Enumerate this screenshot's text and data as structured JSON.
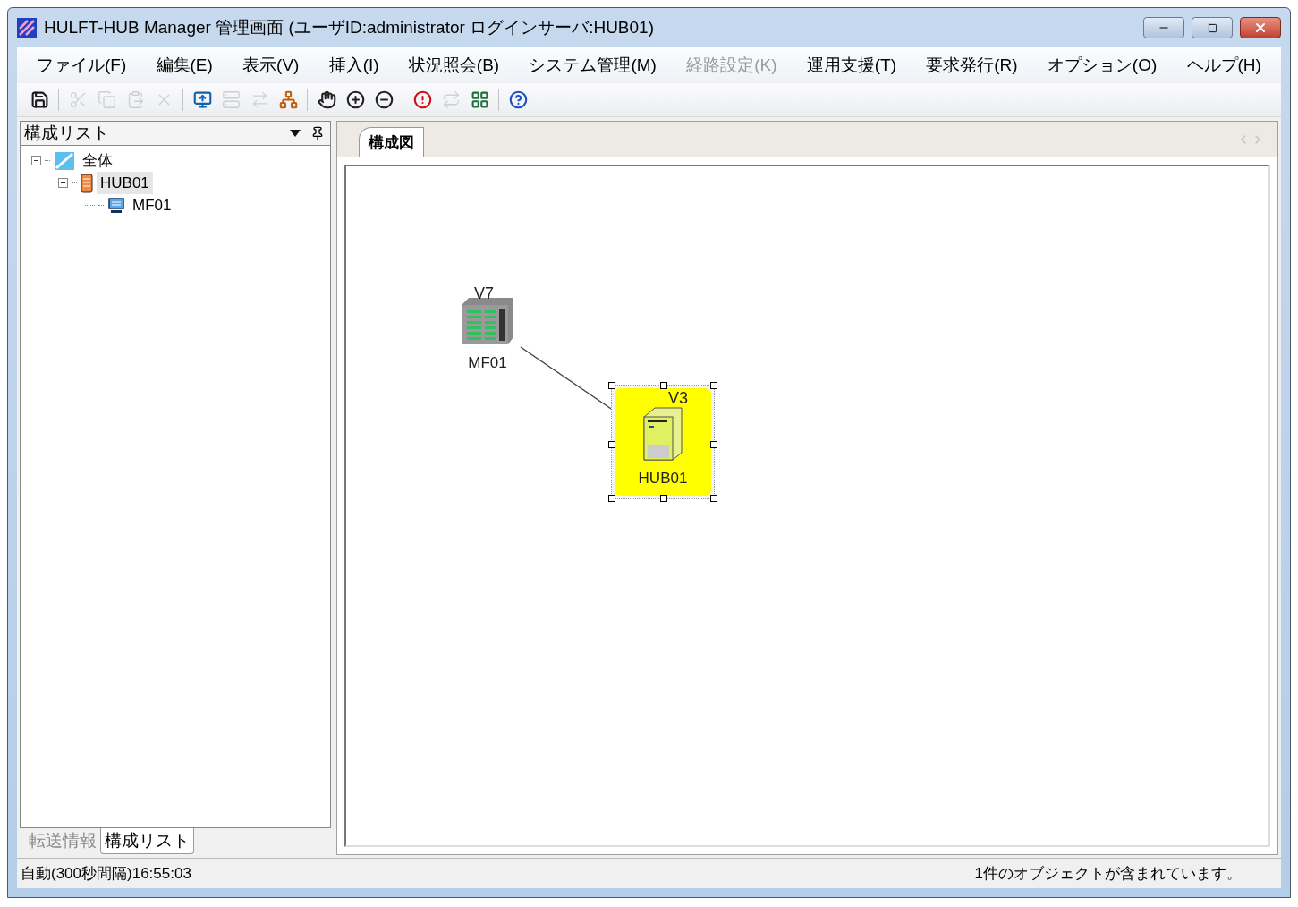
{
  "window": {
    "title": "HULFT-HUB Manager 管理画面 (ユーザID:administrator ログインサーバ:HUB01)"
  },
  "menu": [
    {
      "before": "ファイル(",
      "key": "F",
      "after": ")",
      "disabled": false
    },
    {
      "before": "編集(",
      "key": "E",
      "after": ")",
      "disabled": false
    },
    {
      "before": "表示(",
      "key": "V",
      "after": ")",
      "disabled": false
    },
    {
      "before": "挿入(",
      "key": "I",
      "after": ")",
      "disabled": false
    },
    {
      "before": "状況照会(",
      "key": "B",
      "after": ")",
      "disabled": false
    },
    {
      "before": "システム管理(",
      "key": "M",
      "after": ")",
      "disabled": false
    },
    {
      "before": "経路設定(",
      "key": "K",
      "after": ")",
      "disabled": true
    },
    {
      "before": "運用支援(",
      "key": "T",
      "after": ")",
      "disabled": false
    },
    {
      "before": "要求発行(",
      "key": "R",
      "after": ")",
      "disabled": false
    },
    {
      "before": "オプション(",
      "key": "O",
      "after": ")",
      "disabled": false
    },
    {
      "before": "ヘルプ(",
      "key": "H",
      "after": ")",
      "disabled": false
    }
  ],
  "toolbar": [
    {
      "kind": "save",
      "disabled": false
    },
    {
      "kind": "separator"
    },
    {
      "kind": "cut",
      "disabled": true
    },
    {
      "kind": "copy",
      "disabled": true
    },
    {
      "kind": "paste",
      "disabled": true
    },
    {
      "kind": "delete",
      "disabled": true
    },
    {
      "kind": "separator"
    },
    {
      "kind": "add-monitor",
      "disabled": false
    },
    {
      "kind": "add-server",
      "disabled": true
    },
    {
      "kind": "route",
      "disabled": true
    },
    {
      "kind": "add-network",
      "disabled": false
    },
    {
      "kind": "separator"
    },
    {
      "kind": "hand",
      "disabled": false
    },
    {
      "kind": "zoom-in",
      "disabled": false
    },
    {
      "kind": "zoom-out",
      "disabled": false
    },
    {
      "kind": "separator"
    },
    {
      "kind": "alert",
      "disabled": false
    },
    {
      "kind": "transfer",
      "disabled": true
    },
    {
      "kind": "diagram",
      "disabled": false
    },
    {
      "kind": "separator"
    },
    {
      "kind": "help",
      "disabled": false
    }
  ],
  "left_panel": {
    "title": "構成リスト",
    "tree": [
      {
        "label": "全体",
        "kind": "all",
        "expanded": true,
        "selected": false,
        "children": [
          {
            "label": "HUB01",
            "kind": "hub",
            "expanded": true,
            "selected": true,
            "children": [
              {
                "label": "MF01",
                "kind": "host",
                "selected": false
              }
            ]
          }
        ]
      }
    ],
    "tabs": [
      {
        "label": "転送情報",
        "selected": false
      },
      {
        "label": "構成リスト",
        "selected": true
      }
    ]
  },
  "diagram": {
    "tab": {
      "label": "構成図",
      "selected": true
    },
    "nodes": [
      {
        "kind": "mainframe",
        "name": "MF01",
        "version": "V7",
        "selected": false
      },
      {
        "kind": "server",
        "name": "HUB01",
        "version": "V3",
        "selected": true
      }
    ]
  },
  "status_bar": {
    "left": "自動(300秒間隔)16:55:03",
    "right": "1件のオブジェクトが含まれています。"
  }
}
